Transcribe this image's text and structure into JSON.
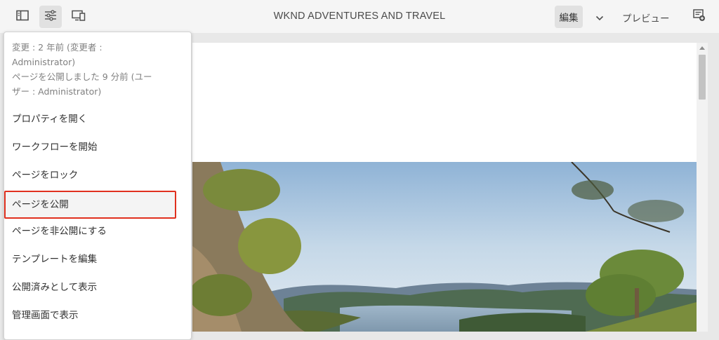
{
  "toolbar": {
    "title": "WKND ADVENTURES AND TRAVEL",
    "edit_label": "編集",
    "preview_label": "プレビュー",
    "icons": [
      "side-panel-icon",
      "page-info-icon",
      "emulator-icon",
      "chevron-down-icon",
      "annotate-icon"
    ]
  },
  "menu": {
    "info_lines": [
      "変更 : 2 年前 (変更者 :",
      "Administrator)",
      "ページを公開しました 9 分前 (ユー",
      "ザー : Administrator)"
    ],
    "items": [
      {
        "label": "プロパティを開く"
      },
      {
        "label": "ワークフローを開始"
      },
      {
        "label": "ページをロック"
      },
      {
        "label": "ページを公開",
        "highlighted": true
      },
      {
        "label": "ページを非公開にする"
      },
      {
        "label": "テンプレートを編集"
      },
      {
        "label": "公開済みとして表示"
      },
      {
        "label": "管理画面で表示"
      }
    ]
  },
  "colors": {
    "highlight_border": "#e0301e",
    "toolbar_bg": "#f5f5f5"
  }
}
